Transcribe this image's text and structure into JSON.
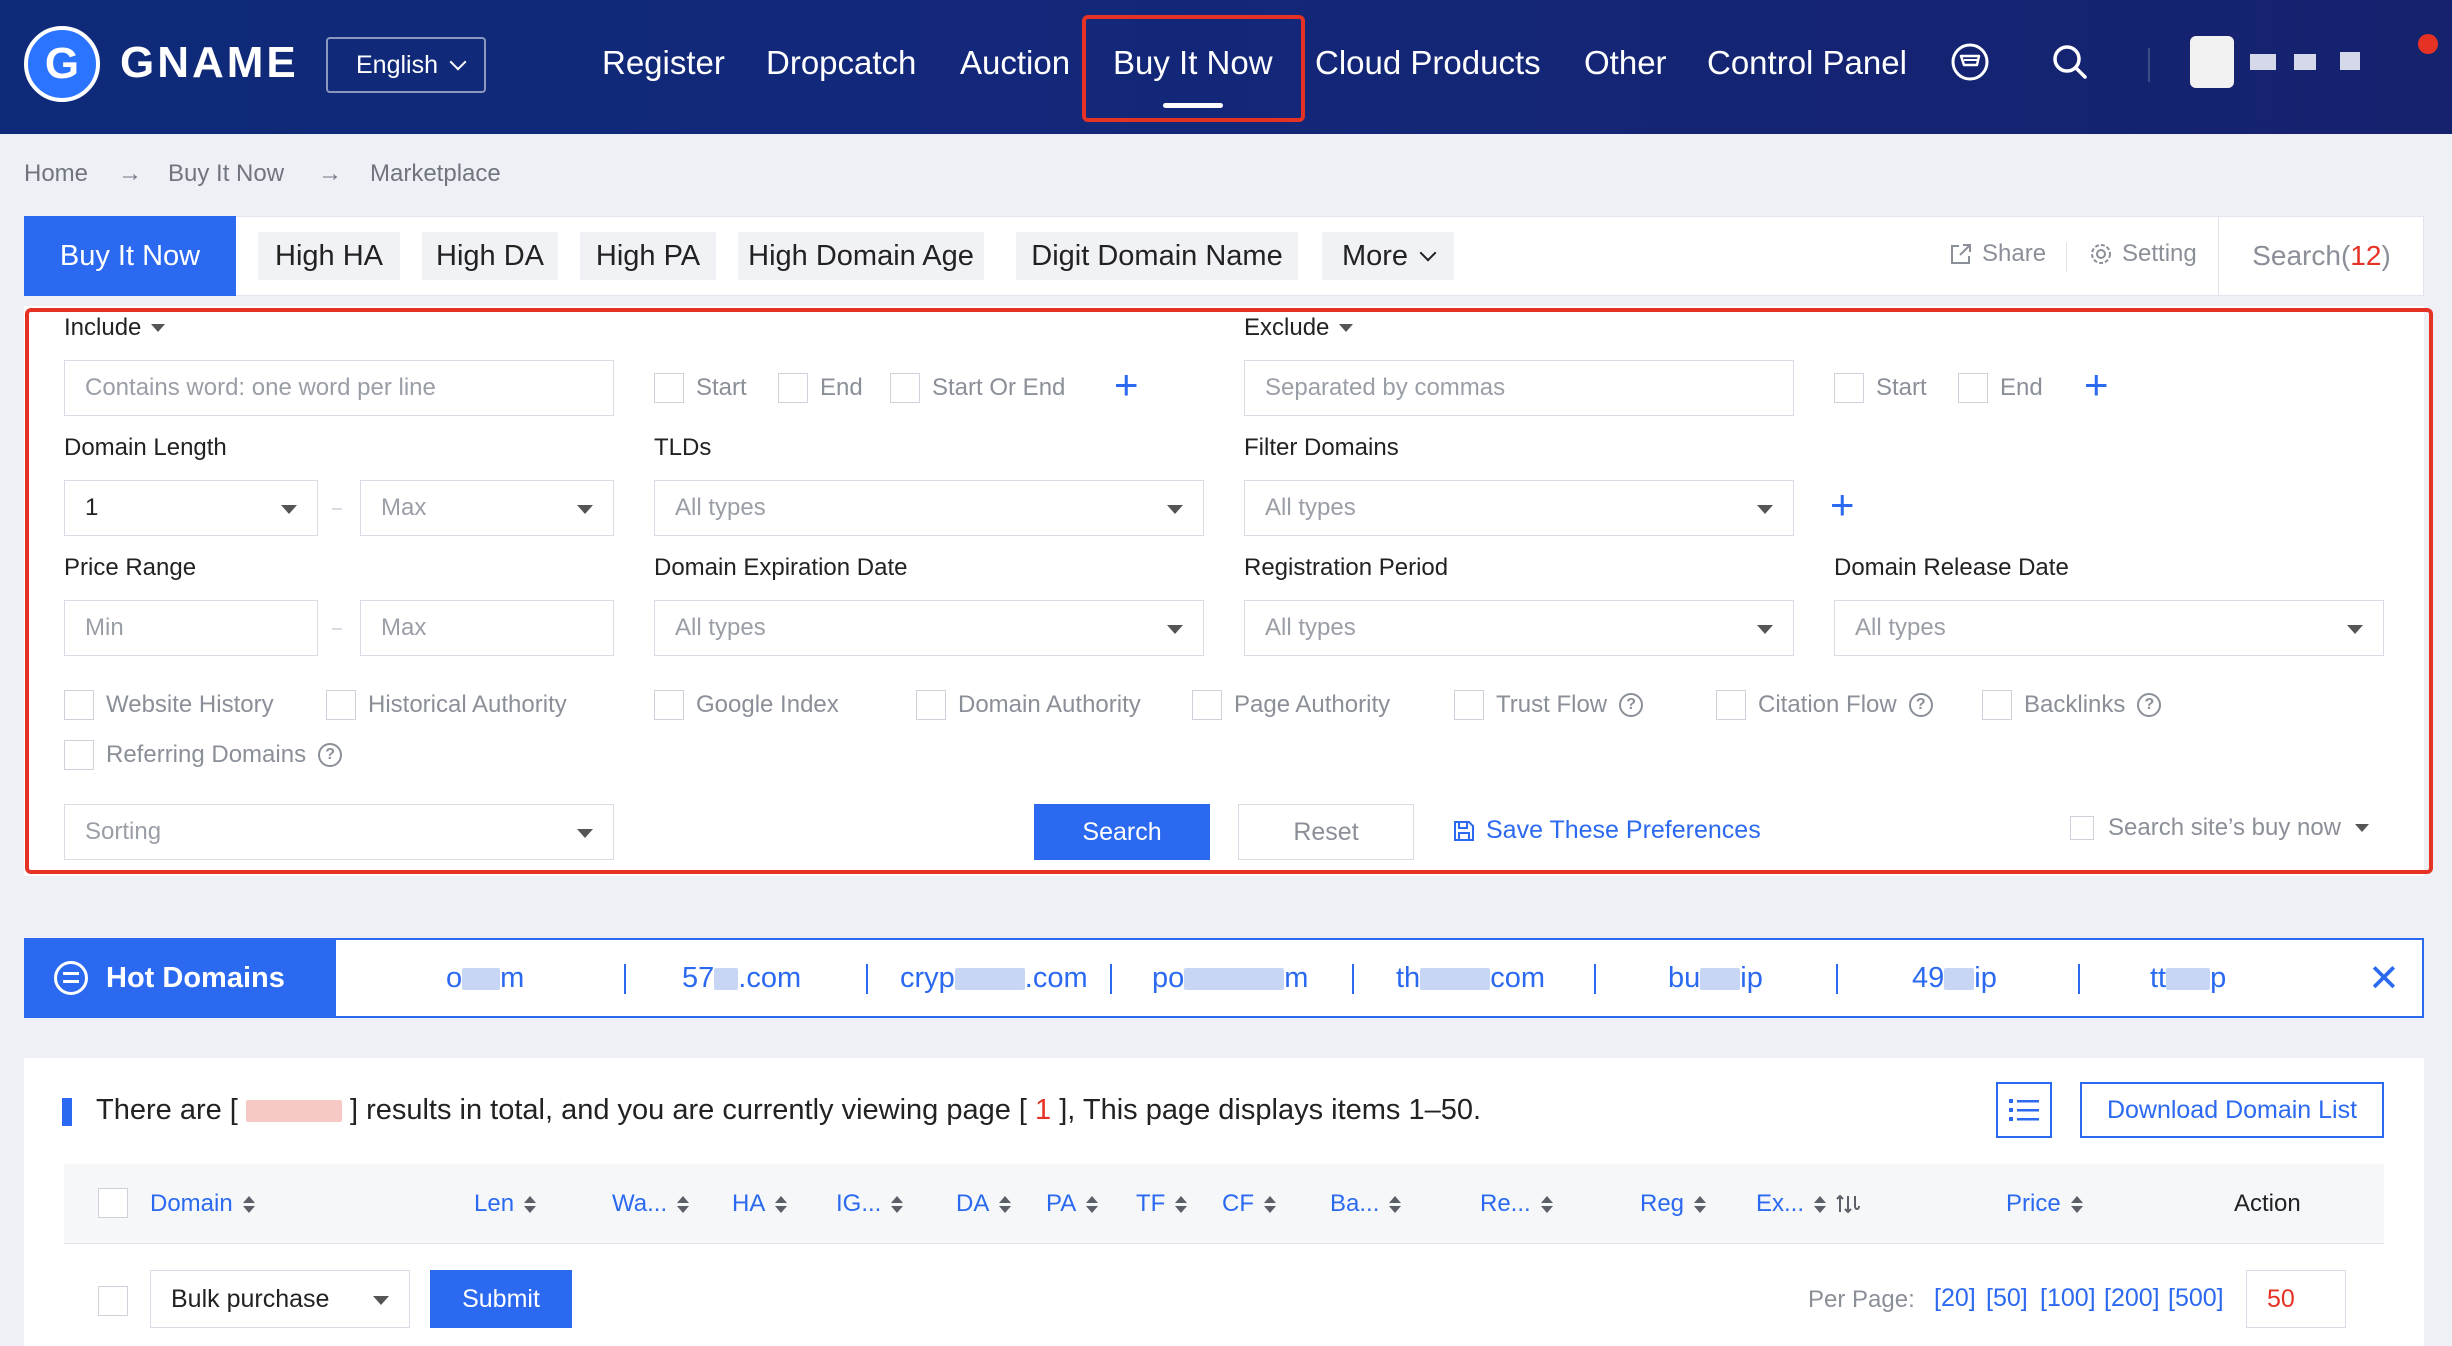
{
  "header": {
    "logo_letter": "G",
    "logo_text": "GNAME",
    "language": "English",
    "nav": [
      "Register",
      "Dropcatch",
      "Auction",
      "Buy It Now",
      "Cloud Products",
      "Other",
      "Control Panel"
    ],
    "active_nav": "Buy It Now"
  },
  "breadcrumb": [
    "Home",
    "Buy It Now",
    "Marketplace"
  ],
  "breadcrumb_sep": "→",
  "tabs": {
    "active": "Buy It Now",
    "items": [
      "High HA",
      "High DA",
      "High PA",
      "High Domain Age",
      "Digit Domain Name",
      "More"
    ],
    "share": "Share",
    "setting": "Setting",
    "search_label": "Search(",
    "search_count": "12",
    "search_close": ")"
  },
  "filters": {
    "include_label": "Include",
    "include_placeholder": "Contains word: one word per line",
    "include_opts": [
      "Start",
      "End",
      "Start Or End"
    ],
    "exclude_label": "Exclude",
    "exclude_placeholder": "Separated by commas",
    "exclude_opts": [
      "Start",
      "End"
    ],
    "domain_length_label": "Domain Length",
    "length_min": "1",
    "length_max": "Max",
    "tlds_label": "TLDs",
    "tlds_value": "All types",
    "filter_domains_label": "Filter Domains",
    "filter_domains_value": "All types",
    "price_range_label": "Price Range",
    "price_min": "Min",
    "price_max": "Max",
    "expiration_label": "Domain Expiration Date",
    "expiration_value": "All types",
    "reg_period_label": "Registration Period",
    "reg_period_value": "All types",
    "release_label": "Domain Release Date",
    "release_value": "All types",
    "checks": [
      "Website History",
      "Historical Authority",
      "Google Index",
      "Domain Authority",
      "Page Authority",
      "Trust Flow",
      "Citation Flow",
      "Backlinks",
      "Referring Domains"
    ],
    "sorting": "Sorting",
    "search_btn": "Search",
    "reset_btn": "Reset",
    "save_pref": "Save These Preferences",
    "site_buynow": "Search site’s buy now"
  },
  "hot": {
    "title": "Hot Domains",
    "items": [
      "o",
      "m",
      "57",
      ".com",
      "cryp",
      ".com",
      "po",
      "m",
      "th",
      "com",
      "bu",
      "ip",
      "49",
      "ip",
      "tt",
      "p"
    ]
  },
  "results": {
    "text_a": "There are [ ",
    "text_b": " ] results in total, and you are currently viewing page [ ",
    "page": "1",
    "text_c": " ], This page displays items 1–50.",
    "download": "Download Domain List",
    "columns": [
      "Domain",
      "Len",
      "Wa...",
      "HA",
      "IG...",
      "DA",
      "PA",
      "TF",
      "CF",
      "Ba...",
      "Re...",
      "Reg",
      "Ex...",
      "Price",
      "Action"
    ],
    "bulk": "Bulk purchase",
    "submit": "Submit",
    "per_page_label": "Per Page:",
    "per_page_opts": [
      "[20]",
      "[50]",
      "[100]",
      "[200]",
      "[500]"
    ],
    "per_page_value": "50"
  }
}
